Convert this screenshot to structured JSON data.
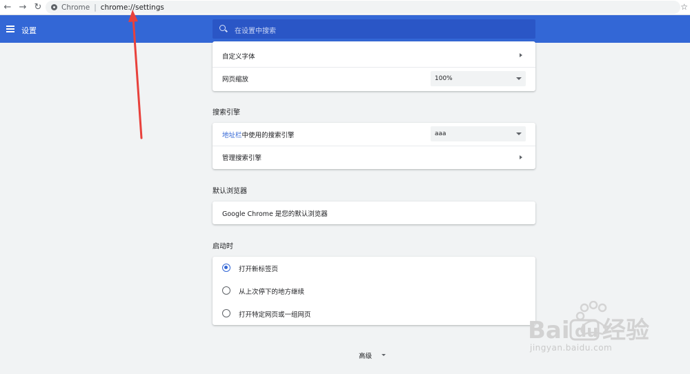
{
  "browser": {
    "address_host": "Chrome",
    "address_path": "chrome://settings"
  },
  "header": {
    "title": "设置",
    "search_placeholder": "在设置中搜索"
  },
  "appearance": {
    "custom_fonts_label": "自定义字体",
    "zoom_label": "网页缩放",
    "zoom_value": "100%"
  },
  "search_engine": {
    "section_title": "搜索引擎",
    "address_bar_link": "地址栏",
    "address_bar_text": "中使用的搜索引擎",
    "engine_value": "aaa",
    "manage_label": "管理搜索引擎"
  },
  "default_browser": {
    "section_title": "默认浏览器",
    "status_text": "Google Chrome 是您的默认浏览器"
  },
  "on_startup": {
    "section_title": "启动时",
    "options": [
      {
        "label": "打开新标签页",
        "checked": true
      },
      {
        "label": "从上次停下的地方继续",
        "checked": false
      },
      {
        "label": "打开特定网页或一组网页",
        "checked": false
      }
    ]
  },
  "footer": {
    "advanced_label": "高级"
  },
  "watermark": {
    "text": "jingyan.baidu.com"
  },
  "colors": {
    "header_blue": "#3367d6",
    "annotation_red": "#e8413c"
  }
}
